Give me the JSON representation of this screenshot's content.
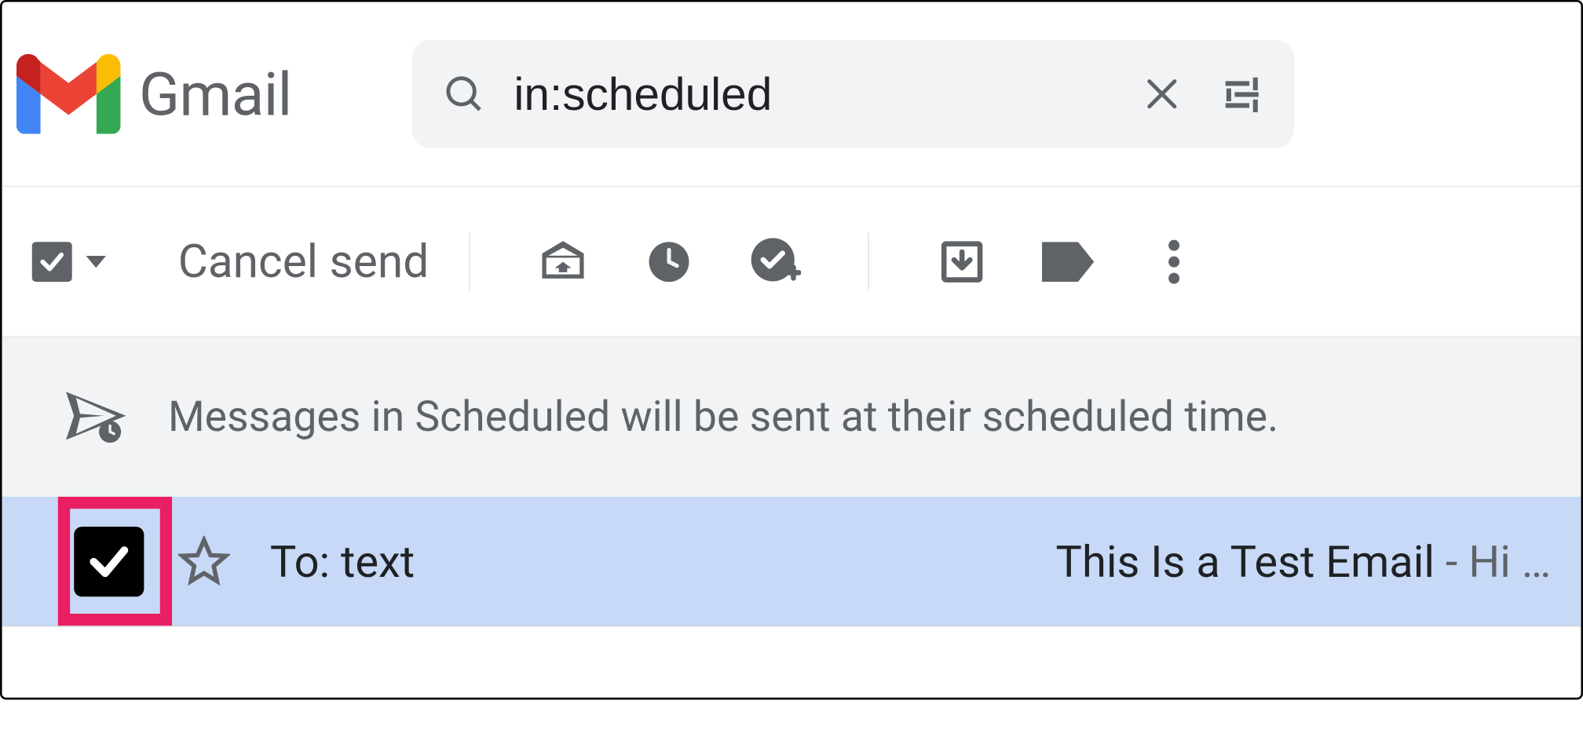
{
  "header": {
    "product_name": "Gmail"
  },
  "search": {
    "value": "in:scheduled"
  },
  "toolbar": {
    "cancel_send_label": "Cancel send"
  },
  "banner": {
    "text": "Messages in Scheduled will be sent at their scheduled time."
  },
  "row": {
    "to_prefix": "To: ",
    "to_name": "text",
    "subject": "This Is a Test Email",
    "separator": " - ",
    "snippet": "Hi …",
    "selected": true
  }
}
